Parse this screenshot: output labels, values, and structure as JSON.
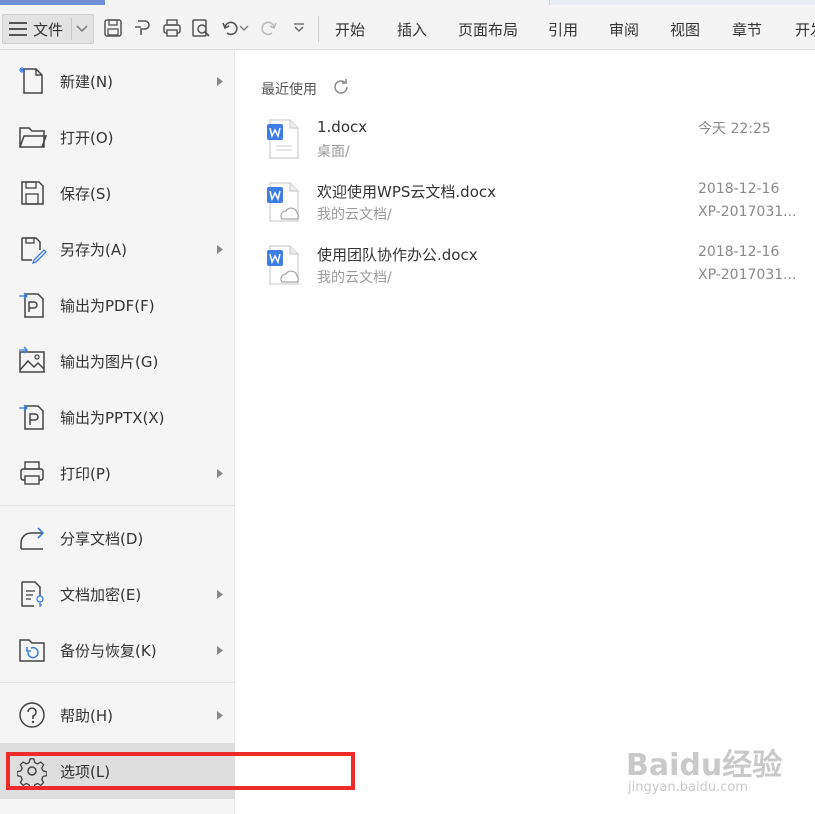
{
  "toolbar": {
    "file_label": "文件",
    "tabs": [
      "开始",
      "插入",
      "页面布局",
      "引用",
      "审阅",
      "视图",
      "章节",
      "开发"
    ]
  },
  "menu": {
    "items": [
      {
        "label": "新建(N)",
        "icon": "new-doc-icon",
        "has_arrow": true
      },
      {
        "label": "打开(O)",
        "icon": "folder-open-icon",
        "has_arrow": false
      },
      {
        "label": "保存(S)",
        "icon": "save-icon",
        "has_arrow": false
      },
      {
        "label": "另存为(A)",
        "icon": "save-as-icon",
        "has_arrow": true
      },
      {
        "label": "输出为PDF(F)",
        "icon": "export-pdf-icon",
        "has_arrow": false
      },
      {
        "label": "输出为图片(G)",
        "icon": "export-image-icon",
        "has_arrow": false
      },
      {
        "label": "输出为PPTX(X)",
        "icon": "export-pptx-icon",
        "has_arrow": false
      },
      {
        "label": "打印(P)",
        "icon": "print-icon",
        "has_arrow": true
      },
      {
        "label": "分享文档(D)",
        "icon": "share-icon",
        "has_arrow": false
      },
      {
        "label": "文档加密(E)",
        "icon": "encrypt-icon",
        "has_arrow": true
      },
      {
        "label": "备份与恢复(K)",
        "icon": "backup-icon",
        "has_arrow": true
      },
      {
        "label": "帮助(H)",
        "icon": "help-icon",
        "has_arrow": true
      },
      {
        "label": "选项(L)",
        "icon": "gear-icon",
        "has_arrow": false
      }
    ]
  },
  "recent": {
    "title": "最近使用",
    "docs": [
      {
        "name": "1.docx",
        "path": "桌面/",
        "date": "今天 22:25",
        "device": ""
      },
      {
        "name": "欢迎使用WPS云文档.docx",
        "path": "我的云文档/",
        "date": "2018-12-16",
        "device": "XP-2017031..."
      },
      {
        "name": "使用团队协作办公.docx",
        "path": "我的云文档/",
        "date": "2018-12-16",
        "device": "XP-2017031..."
      }
    ]
  },
  "watermark": {
    "text": "Baidu经验",
    "sub": "jingyan.baidu.com"
  },
  "colors": {
    "accent": "#6f8fd6",
    "highlight": "#ee2b2b",
    "doc_blue": "#3d7de4"
  }
}
